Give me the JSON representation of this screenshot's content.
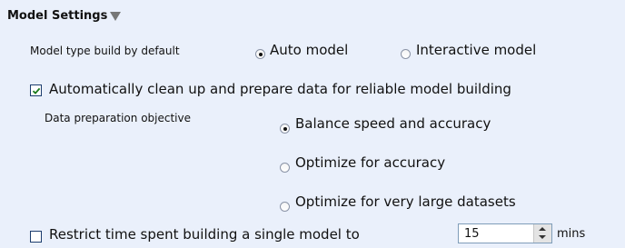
{
  "section": {
    "title": "Model Settings"
  },
  "model_type": {
    "label": "Model type build by default",
    "options": [
      {
        "label": "Auto model",
        "selected": true
      },
      {
        "label": "Interactive model",
        "selected": false
      }
    ]
  },
  "auto_clean": {
    "label": "Automatically clean up and prepare data for reliable model building",
    "checked": true
  },
  "prep_objective": {
    "label": "Data preparation objective",
    "options": [
      {
        "label": "Balance speed and accuracy",
        "selected": true
      },
      {
        "label": "Optimize for accuracy",
        "selected": false
      },
      {
        "label": "Optimize for very large datasets",
        "selected": false
      }
    ]
  },
  "restrict_time": {
    "label": "Restrict time spent building a single model to",
    "checked": false,
    "value": "15",
    "unit": "mins"
  }
}
